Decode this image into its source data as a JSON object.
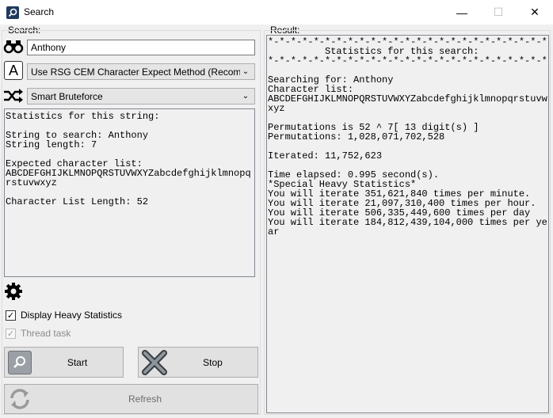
{
  "window": {
    "title": "Search",
    "minimize": "—",
    "maximize": "☐",
    "close": "✕"
  },
  "left": {
    "group_label": "Search:",
    "search_value": "Anthony",
    "method_selected": "Use RSG CEM Character Expect Method (Recommended)",
    "mode_selected": "Smart Bruteforce",
    "stats_text": "Statistics for this string:\n\nString to search: Anthony\nString length: 7\n\nExpected character list:\nABCDEFGHIJKLMNOPQRSTUVWXYZabcdefghijklmnopqrstuvwxyz\n\nCharacter List Length: 52",
    "display_heavy_label": "Display Heavy Statistics",
    "display_heavy_checked": true,
    "thread_task_label": "Thread task",
    "thread_task_checked": true,
    "start_label": "Start",
    "stop_label": "Stop",
    "refresh_label": "Refresh"
  },
  "right": {
    "group_label": "Result:",
    "result_text": "*-*-*-*-*-*-*-*-*-*-*-*-*-*-*-*-*-*-*-*-*-*-*-*-*\n          Statistics for this search:\n*-*-*-*-*-*-*-*-*-*-*-*-*-*-*-*-*-*-*-*-*-*-*-*-*\n\nSearching for: Anthony\nCharacter list:\nABCDEFGHIJKLMNOPQRSTUVWXYZabcdefghijklmnopqrstuvwxyz\n\nPermutations is 52 ^ 7[ 13 digit(s) ]\nPermutations: 1,028,071,702,528\n\nIterated: 11,752,623\n\nTime elapsed: 0.995 second(s).\n*Special Heavy Statistics*\nYou will iterate 351,621,840 times per minute.\nYou will iterate 21,097,310,400 times per hour.\nYou will iterate 506,335,449,600 times per day\nYou will iterate 184,812,439,104,000 times per year"
  }
}
